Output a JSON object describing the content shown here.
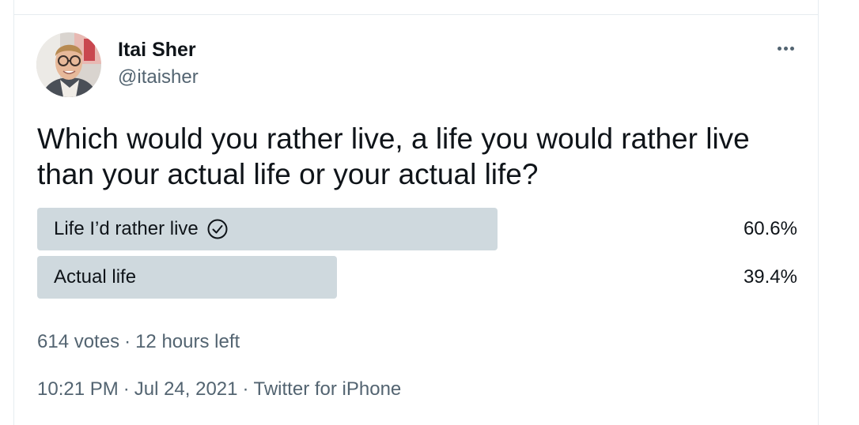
{
  "author": {
    "name": "Itai Sher",
    "handle": "@itaisher"
  },
  "more_icon": "more-horizontal-icon",
  "tweet": {
    "text": "Which would you rather live, a life you would rather live than your actual life or your actual life?"
  },
  "poll": {
    "options": [
      {
        "label": "Life I’d rather live",
        "percent_text": "60.6%",
        "percent": 60.6,
        "selected": true
      },
      {
        "label": "Actual life",
        "percent_text": "39.4%",
        "percent": 39.4,
        "selected": false
      }
    ],
    "votes": "614 votes",
    "time_left": "12 hours left"
  },
  "footer": {
    "time": "10:21 PM",
    "date": "Jul 24, 2021",
    "source": "Twitter for iPhone"
  },
  "colors": {
    "bar": "#cfd9de",
    "secondary_text": "#536471",
    "primary_text": "#0f1419"
  }
}
